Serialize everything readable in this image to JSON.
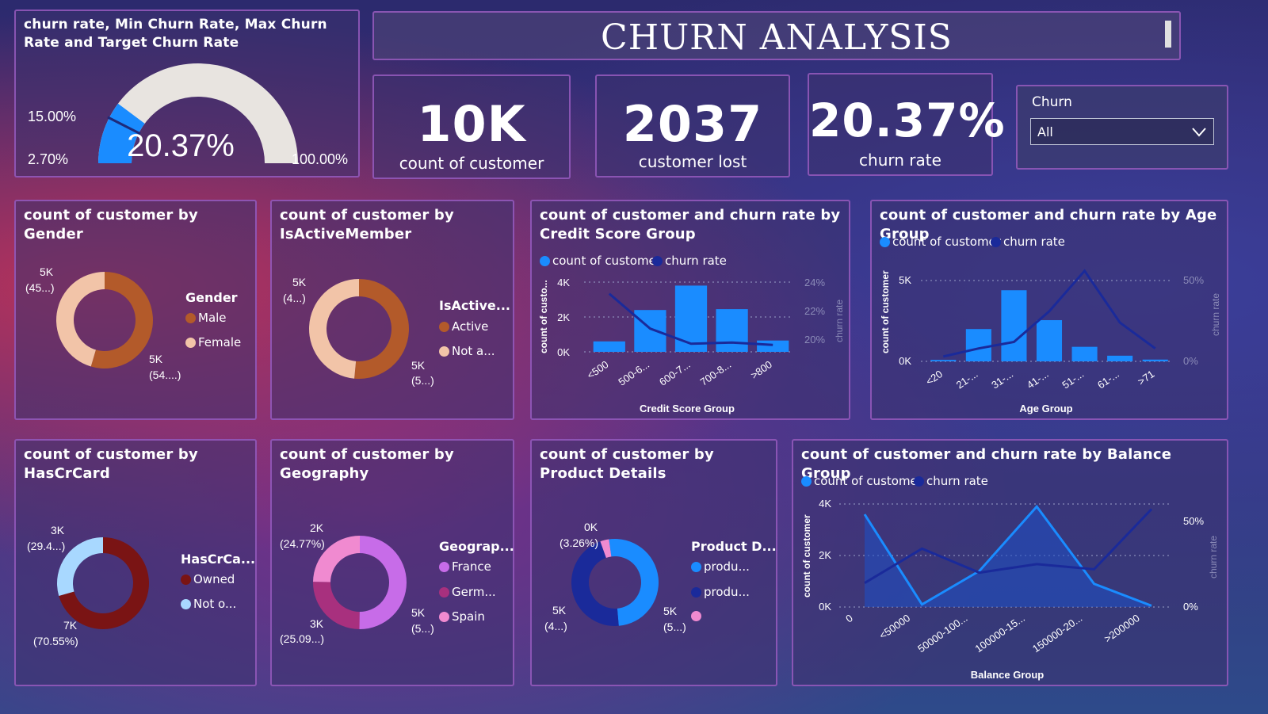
{
  "banner": {
    "title": "CHURN ANALYSIS"
  },
  "gauge": {
    "title": "churn rate, Min Churn Rate, Max Churn Rate and Target Churn Rate",
    "value": "20.37%",
    "min_label": "2.70%",
    "max_label": "100.00%",
    "target_label": "15.00%",
    "value_fraction": 0.2037,
    "target_fraction": 0.15,
    "colors": {
      "fill": "#1a8cff",
      "track": "#e8e4e0",
      "target": "#1e2a7a"
    }
  },
  "kpis": [
    {
      "value": "10K",
      "label": "count of customer"
    },
    {
      "value": "2037",
      "label": "customer lost"
    },
    {
      "value": "20.37%",
      "label": "churn rate"
    }
  ],
  "slicer": {
    "title": "Churn",
    "selected": "All"
  },
  "gender_chart": {
    "title": "count of customer by Gender",
    "legend_title": "Gender",
    "legend": [
      "Male",
      "Female"
    ],
    "labels": {
      "top": "5K",
      "top_pct": "(45...)",
      "bottom": "5K",
      "bottom_pct": "(54....)"
    },
    "colors": [
      "#b35a2a",
      "#f2c4a8"
    ]
  },
  "active_chart": {
    "title": "count of customer by IsActiveMember",
    "legend_title": "IsActive...",
    "legend": [
      "Active",
      "Not a..."
    ],
    "labels": {
      "top": "5K",
      "top_pct": "(4...)",
      "bottom": "5K",
      "bottom_pct": "(5...)"
    },
    "colors": [
      "#b35a2a",
      "#f2c4a8"
    ]
  },
  "credit_chart": {
    "title": "count of customer and churn rate by Credit Score Group",
    "legend": [
      "count of customer",
      "churn rate"
    ],
    "y_axis": "count of custo...",
    "y2_axis": "churn rate",
    "x_axis": "Credit Score Group",
    "y_ticks": [
      "4K",
      "2K",
      "0K"
    ],
    "y2_ticks": [
      "24%",
      "22%",
      "20%"
    ],
    "categories": [
      "<500",
      "500-6...",
      "600-7...",
      "700-8...",
      ">800"
    ]
  },
  "age_chart": {
    "title": "count of customer and churn rate by Age Group",
    "legend": [
      "count of customer",
      "churn rate"
    ],
    "y_axis": "count of customer",
    "y2_axis": "churn rate",
    "x_axis": "Age Group",
    "y_ticks": [
      "5K",
      "0K"
    ],
    "y2_ticks": [
      "50%",
      "0%"
    ],
    "categories": [
      "<20",
      "21-...",
      "31-...",
      "41-...",
      "51-...",
      "61-...",
      ">71"
    ]
  },
  "card_chart": {
    "title": "count of customer by HasCrCard",
    "legend_title": "HasCrCa...",
    "legend": [
      "Owned",
      "Not o..."
    ],
    "labels": {
      "top": "3K",
      "top_pct": "(29.4...)",
      "bottom": "7K",
      "bottom_pct": "(70.55%)"
    },
    "colors": [
      "#7a1414",
      "#a8d8ff"
    ]
  },
  "geo_chart": {
    "title": "count of customer by Geography",
    "legend_title": "Geograp...",
    "legend": [
      "France",
      "Germ...",
      "Spain"
    ],
    "labels": {
      "top": "2K",
      "top_pct": "(24.77%)",
      "bottom": "3K",
      "bottom_pct": "(25.09...)",
      "right": "5K",
      "right_pct": "(5...)"
    },
    "colors": [
      "#c76ce8",
      "#a8307e",
      "#f08ad0"
    ]
  },
  "product_chart": {
    "title": "count of customer by Product Details",
    "legend_title": "Product D...",
    "legend": [
      "produ...",
      "produ...",
      ""
    ],
    "labels": {
      "top": "0K",
      "top_pct": "(3.26%)",
      "left": "5K",
      "left_pct": "(4...)",
      "right": "5K",
      "right_pct": "(5...)"
    },
    "colors": [
      "#1a8cff",
      "#1a2a9a",
      "#f08ad0"
    ]
  },
  "balance_chart": {
    "title": "count of customer and churn rate by Balance Group",
    "legend": [
      "count of customer",
      "churn rate"
    ],
    "y_axis": "count of customer",
    "y2_axis": "churn rate",
    "x_axis": "Balance Group",
    "y_ticks": [
      "4K",
      "2K",
      "0K"
    ],
    "y2_ticks": [
      "50%",
      "0%"
    ],
    "categories": [
      "0",
      "<50000",
      "50000-100...",
      "100000-15...",
      "150000-20...",
      ">200000"
    ]
  },
  "chart_data": [
    {
      "type": "bar",
      "title": "count of customer and churn rate by Credit Score Group",
      "xlabel": "Credit Score Group",
      "ylabel": "count of custo...",
      "categories": [
        "<500",
        "500-6...",
        "600-7...",
        "700-8...",
        ">800"
      ],
      "ylim": [
        0,
        4000
      ],
      "y2lim": [
        19,
        25
      ],
      "series": [
        {
          "name": "count of customer",
          "type": "bar",
          "values": [
            600,
            2400,
            3800,
            2450,
            650
          ]
        },
        {
          "name": "churn rate",
          "type": "line",
          "axis": "y2",
          "values": [
            24.0,
            21.0,
            19.7,
            19.8,
            19.6
          ]
        }
      ]
    },
    {
      "type": "bar",
      "title": "count of customer and churn rate by Age Group",
      "xlabel": "Age Group",
      "ylabel": "count of customer",
      "categories": [
        "<20",
        "21-...",
        "31-...",
        "41-...",
        "51-...",
        "61-...",
        ">71"
      ],
      "ylim": [
        0,
        5000
      ],
      "y2lim": [
        0,
        50
      ],
      "series": [
        {
          "name": "count of customer",
          "type": "bar",
          "values": [
            90,
            2000,
            4400,
            2550,
            900,
            350,
            110
          ]
        },
        {
          "name": "churn rate",
          "type": "line",
          "axis": "y2",
          "values": [
            3,
            8,
            12,
            31,
            56,
            24,
            8
          ]
        }
      ]
    },
    {
      "type": "area",
      "title": "count of customer and churn rate by Balance Group",
      "xlabel": "Balance Group",
      "ylabel": "count of customer",
      "categories": [
        "0",
        "<50000",
        "50000-100...",
        "100000-15...",
        "150000-20...",
        ">200000"
      ],
      "ylim": [
        0,
        4000
      ],
      "y2lim": [
        0,
        60
      ],
      "series": [
        {
          "name": "count of customer",
          "type": "area",
          "values": [
            3600,
            100,
            1400,
            3900,
            900,
            50
          ]
        },
        {
          "name": "churn rate",
          "type": "line",
          "axis": "y2",
          "values": [
            14,
            34,
            20,
            25,
            22,
            57
          ]
        }
      ]
    },
    {
      "type": "pie",
      "title": "count of customer by Gender",
      "categories": [
        "Male",
        "Female"
      ],
      "values": [
        54.57,
        45.43
      ]
    },
    {
      "type": "pie",
      "title": "count of customer by IsActiveMember",
      "categories": [
        "Active",
        "Not a..."
      ],
      "values": [
        51.5,
        48.5
      ]
    },
    {
      "type": "pie",
      "title": "count of customer by HasCrCard",
      "categories": [
        "Owned",
        "Not o..."
      ],
      "values": [
        70.55,
        29.45
      ]
    },
    {
      "type": "pie",
      "title": "count of customer by Geography",
      "categories": [
        "France",
        "Germ...",
        "Spain"
      ],
      "values": [
        50.14,
        25.09,
        24.77
      ]
    },
    {
      "type": "pie",
      "title": "count of customer by Product Details",
      "categories": [
        "produ...",
        "produ...",
        ""
      ],
      "values": [
        50.84,
        45.9,
        3.26
      ]
    }
  ]
}
